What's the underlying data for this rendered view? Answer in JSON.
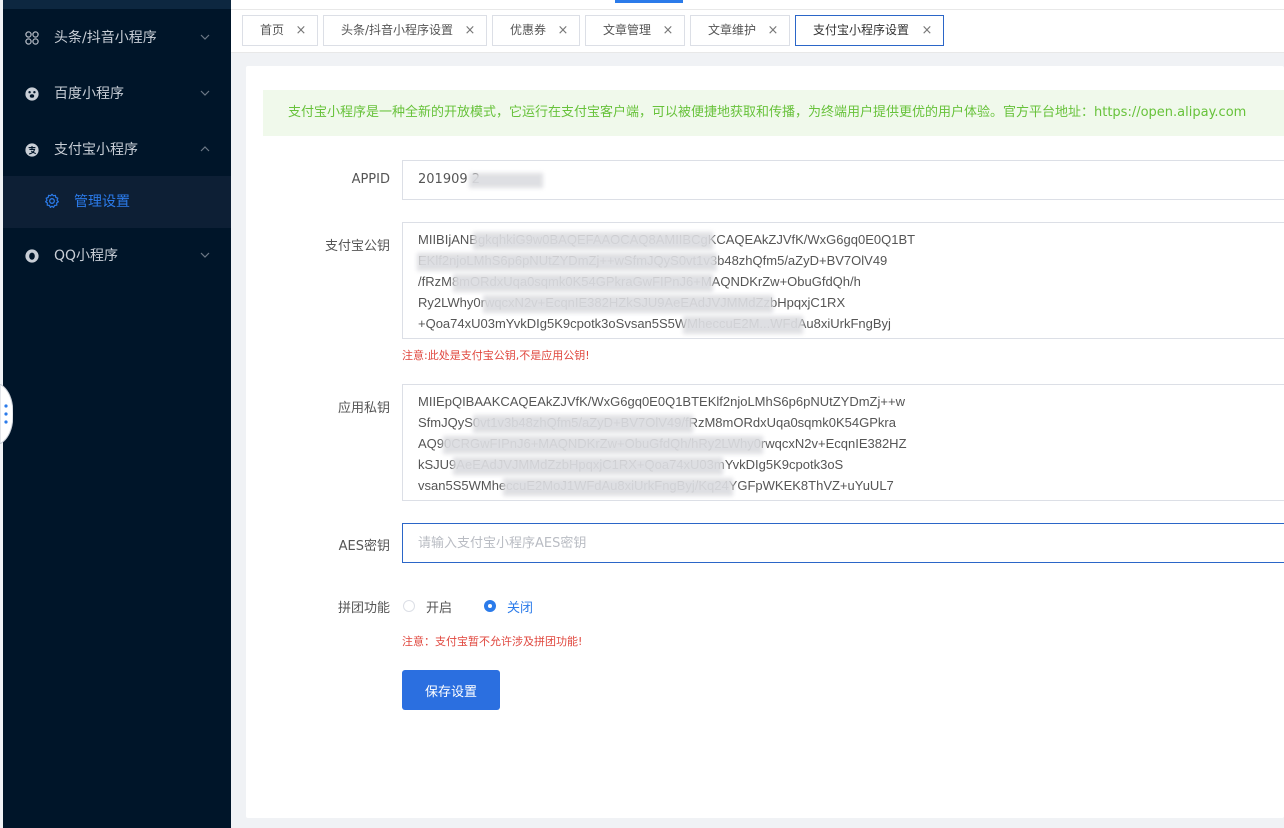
{
  "sidebar": {
    "items": [
      {
        "label": "头条/抖音小程序",
        "icon": "grid-icon",
        "expanded": false
      },
      {
        "label": "百度小程序",
        "icon": "baidu-icon",
        "expanded": false
      },
      {
        "label": "支付宝小程序",
        "icon": "alipay-icon",
        "expanded": true
      },
      {
        "label": "QQ小程序",
        "icon": "qq-icon",
        "expanded": false
      }
    ],
    "sub_item": {
      "label": "管理设置",
      "icon": "gear-icon"
    }
  },
  "tabs": [
    {
      "label": "首页",
      "close": "×"
    },
    {
      "label": "头条/抖音小程序设置",
      "close": "×"
    },
    {
      "label": "优惠券",
      "close": "×"
    },
    {
      "label": "文章管理",
      "close": "×"
    },
    {
      "label": "文章维护",
      "close": "×"
    },
    {
      "label": "支付宝小程序设置",
      "close": "×",
      "active": true
    }
  ],
  "notice": "支付宝小程序是一种全新的开放模式，它运行在支付宝客户端，可以被便捷地获取和传播，为终端用户提供更优的用户体验。官方平台地址：https://open.alipay.com",
  "form": {
    "appid": {
      "label": "APPID",
      "value": "201909                    2"
    },
    "public_key": {
      "label": "支付宝公钥",
      "value": "MIIBIjANBgkqhkiG9w0BAQEFAAOCAQ8AMIIBCgKCAQEAkZJVfK/WxG6gq0E0Q1BT\nEKlf2njoLMhS6p6pNUtZYDmZj++wSfmJQyS0vt1v3b48zhQfm5/aZyD+BV7OlV49\n/fRzM8mORdxUqa0sqmk0K54GPkraGwFIPnJ6+MAQNDKrZw+ObuGfdQh/h\nRy2LWhy0rwqcxN2v+EcqnIE382HZkSJU9AeEAdJVJMMdZzbHpqxjC1RX\n+Qoa74xU03mYvkDIg5K9cpotk3oSvsan5S5WMheccuE2M...WFdAu8xiUrkFngByj",
      "hint": "注意:此处是支付宝公钥,不是应用公钥!"
    },
    "private_key": {
      "label": "应用私钥",
      "value": "MIIEpQIBAAKCAQEAkZJVfK/WxG6gq0E0Q1BTEKlf2njoLMhS6p6pNUtZYDmZj++w\nSfmJQyS0vt1v3b48zhQfm5/aZyD+BV7OlV49/fRzM8mORdxUqa0sqmk0K54GPkra\nAQ90CRGwFIPnJ6+MAQNDKrZw+ObuGfdQh/hRy2LWhy0rwqcxN2v+EcqnIE382HZ\nkSJU9AeEAdJVJMMdZzbHpqxjC1RX+Qoa74xU03mYvkDIg5K9cpotk3oS\nvsan5S5WMheccuE2MoJ1WFdAu8xiUrkFngByj/Kq24YGFpWKEK8ThVZ+uYuUL7"
    },
    "aes_key": {
      "label": "AES密钥",
      "placeholder": "请输入支付宝小程序AES密钥",
      "value": ""
    },
    "group_buy": {
      "label": "拼团功能",
      "options": [
        {
          "label": "开启",
          "selected": false
        },
        {
          "label": "关闭",
          "selected": true
        }
      ],
      "hint": "注意：支付宝暂不允许涉及拼团功能!"
    },
    "save_label": "保存设置"
  },
  "colors": {
    "sidebar_bg": "#001529",
    "accent": "#2b7bea",
    "notice_bg": "#f0f9eb",
    "notice_text": "#67c23a",
    "hint_text": "#e0473e"
  }
}
